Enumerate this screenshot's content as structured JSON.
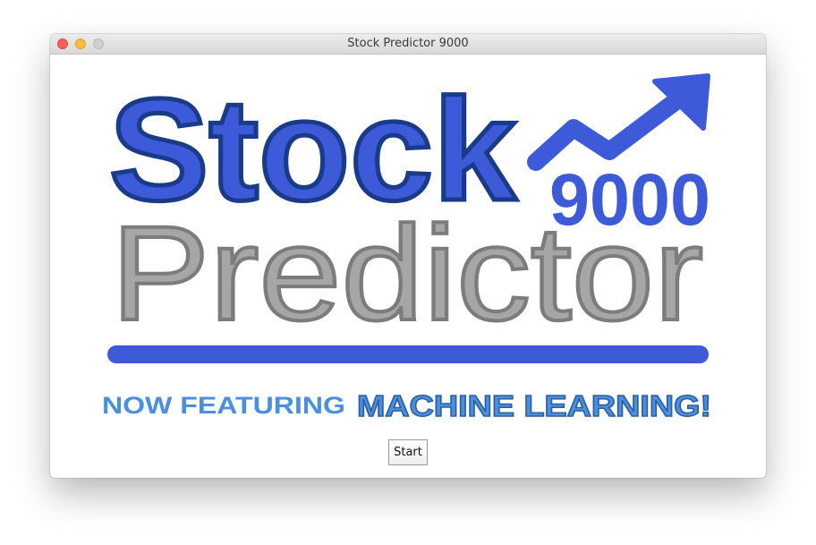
{
  "window": {
    "title": "Stock Predictor 9000"
  },
  "logo": {
    "word_top": "Stock",
    "word_bottom": "Predictor",
    "number": "9000",
    "tagline_prefix": "NOW FEATURING",
    "tagline_highlight": "MACHINE LEARNING!",
    "trend_icon": "trending-up-arrow-icon"
  },
  "colors": {
    "brand_blue": "#3d5bd9",
    "brand_blue_outline": "#1a3a8a",
    "gray": "#a6a6a6",
    "gray_outline": "#7c7c7c",
    "tagline_blue": "#4a90e2",
    "close": "#fc605c",
    "minimize": "#fdbc40",
    "zoom": "#cfcfcf"
  },
  "controls": {
    "start_label": "Start"
  }
}
